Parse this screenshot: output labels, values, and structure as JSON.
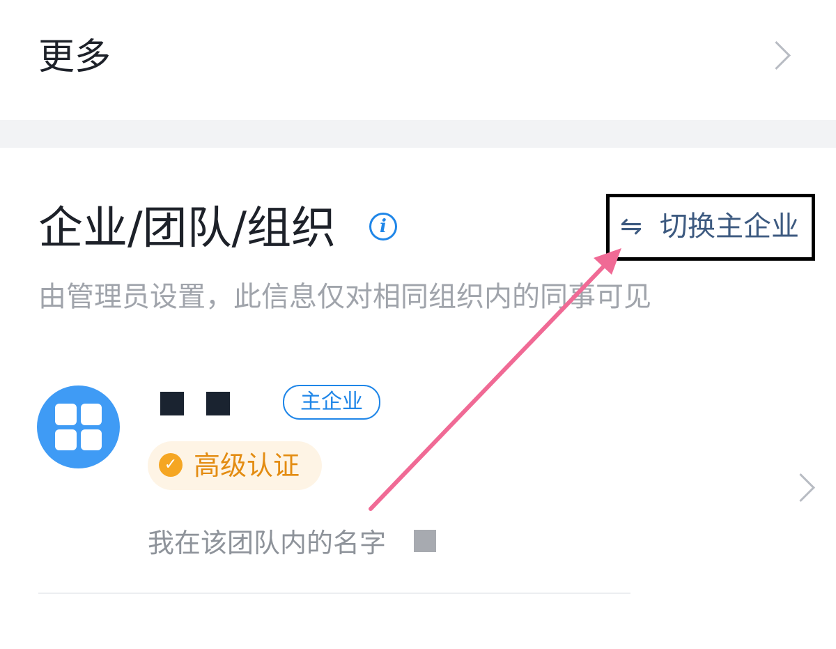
{
  "more_row": {
    "label": "更多"
  },
  "org_section": {
    "title": "企业/团队/组织",
    "info_icon_glyph": "i",
    "switch_icon_glyph": "⇋",
    "switch_label": "切换主企业",
    "description": "由管理员设置，此信息仅对相同组织内的同事可见"
  },
  "org_item": {
    "main_badge": "主企业",
    "cert_label": "高级认证",
    "cert_icon_glyph": "✓",
    "member_name_label": "我在该团队内的名字"
  },
  "colors": {
    "accent_blue": "#1f86e8",
    "avatar_blue": "#3f9bf5",
    "cert_orange": "#f5a623",
    "annotation_pink": "#f06a95"
  }
}
